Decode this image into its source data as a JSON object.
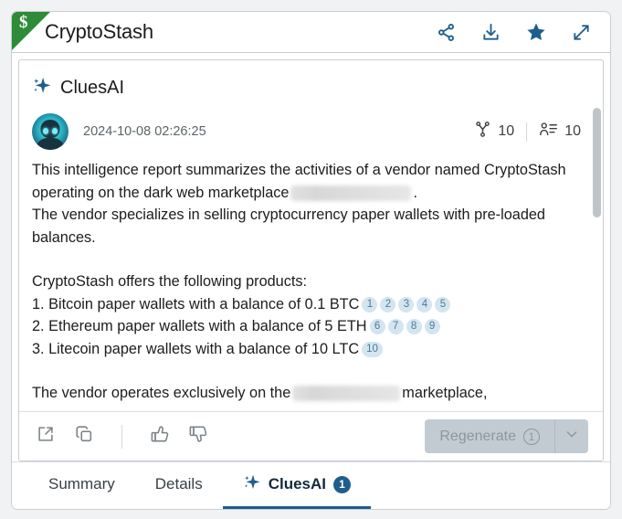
{
  "window": {
    "corner_badge": "$",
    "title": "CryptoStash",
    "actions": [
      {
        "name": "share-icon",
        "label": "Share"
      },
      {
        "name": "download-icon",
        "label": "Download"
      },
      {
        "name": "star-icon",
        "label": "Favorite"
      },
      {
        "name": "expand-icon",
        "label": "Expand"
      }
    ]
  },
  "panel": {
    "heading": "CluesAI",
    "heading_icon": "sparkle-icon"
  },
  "message": {
    "avatar_name": "ai-robot-avatar",
    "timestamp": "2024-10-08 02:26:25",
    "counters": [
      {
        "icon": "branch-icon",
        "value": "10"
      },
      {
        "icon": "people-list-icon",
        "value": "10"
      }
    ],
    "paragraph1_a": "This intelligence report summarizes the activities of a vendor named CryptoStash operating on the dark web marketplace",
    "paragraph1_b": ".",
    "paragraph2": "The vendor specializes in selling cryptocurrency paper wallets with pre-loaded balances.",
    "products_intro": "CryptoStash offers the following products:",
    "products": [
      {
        "text": "1. Bitcoin paper wallets with a balance of 0.1 BTC",
        "citations": [
          "1",
          "2",
          "3",
          "4",
          "5"
        ]
      },
      {
        "text": "2. Ethereum paper wallets with a balance of 5 ETH",
        "citations": [
          "6",
          "7",
          "8",
          "9"
        ]
      },
      {
        "text": "3. Litecoin paper wallets with a balance of 10 LTC",
        "citations": [
          "10"
        ]
      }
    ],
    "paragraph3_a": "The vendor operates exclusively on the",
    "paragraph3_b": "marketplace,",
    "redaction_note": "redacted-block"
  },
  "action_bar": {
    "icons": [
      {
        "name": "open-external-icon",
        "label": "Open in new window"
      },
      {
        "name": "copy-icon",
        "label": "Copy"
      },
      {
        "name": "thumbs-up-icon",
        "label": "Helpful"
      },
      {
        "name": "thumbs-down-icon",
        "label": "Not helpful"
      }
    ],
    "regenerate_label": "Regenerate",
    "regenerate_count": "1",
    "regenerate_caret": "chevron-down-icon"
  },
  "tabs": [
    {
      "label": "Summary",
      "active": false,
      "badge": null,
      "icon": null
    },
    {
      "label": "Details",
      "active": false,
      "badge": null,
      "icon": null
    },
    {
      "label": "CluesAI",
      "active": true,
      "badge": "1",
      "icon": "sparkle-icon"
    }
  ],
  "colors": {
    "accent_blue": "#1d5e8c",
    "corner_green": "#2e8b38",
    "citation_bg": "#d3e5f0",
    "citation_text": "#4e7b94",
    "disabled_button": "#c3cbd2",
    "page_bg": "#f0f2f4"
  }
}
